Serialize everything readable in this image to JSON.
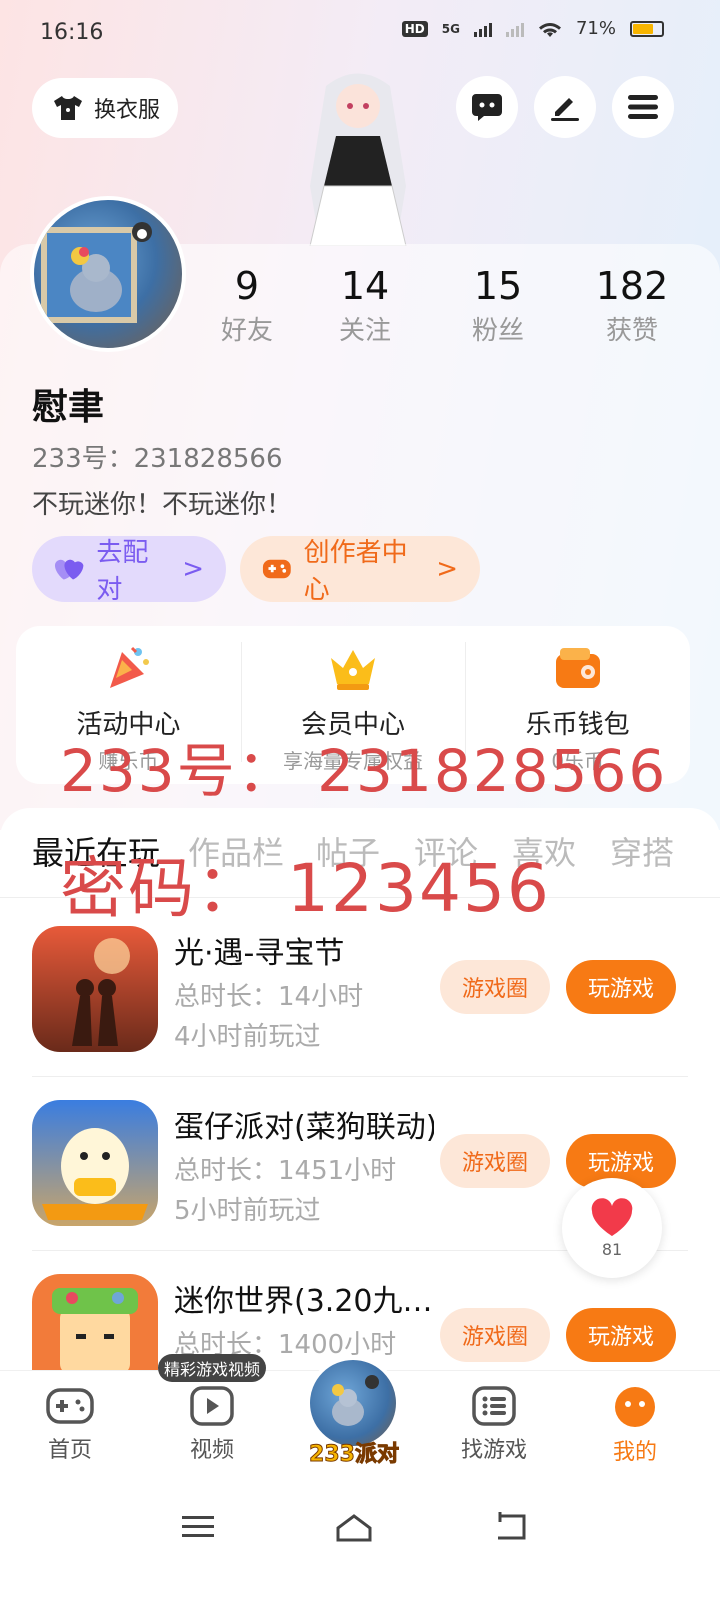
{
  "status_bar": {
    "time": "16:16",
    "hd": "HD",
    "network": "5G",
    "battery": "71%"
  },
  "header": {
    "outfit_label": "换衣服"
  },
  "profile": {
    "stats": [
      {
        "value": "9",
        "label": "好友"
      },
      {
        "value": "14",
        "label": "关注"
      },
      {
        "value": "15",
        "label": "粉丝"
      },
      {
        "value": "182",
        "label": "获赞"
      }
    ],
    "name": "慰聿",
    "uid": "233号：231828566",
    "bio": "不玩迷你！不玩迷你！",
    "match_label": "去配对",
    "creator_label": "创作者中心",
    "chevron": ">"
  },
  "entries": [
    {
      "title": "活动中心",
      "sub": "赚乐币"
    },
    {
      "title": "会员中心",
      "sub": "享海量专属权益"
    },
    {
      "title": "乐币钱包",
      "sub": "0乐币"
    }
  ],
  "watermark": {
    "line1": "233号： 231828566",
    "line2": "密码： 123456"
  },
  "tabs": [
    "最近在玩",
    "作品栏",
    "帖子",
    "评论",
    "喜欢",
    "穿搭"
  ],
  "games": [
    {
      "title": "光·遇-寻宝节",
      "total": "总时长：14小时",
      "last": "4小时前玩过"
    },
    {
      "title": "蛋仔派对(菜狗联动)",
      "total": "总时长：1451小时",
      "last": "5小时前玩过"
    },
    {
      "title": "迷你世界(3.20九…",
      "total": "总时长：1400小时",
      "last": ""
    }
  ],
  "game_buttons": {
    "circle": "游戏圈",
    "play": "玩游戏"
  },
  "like_count": "81",
  "nav": {
    "tooltip": "精彩游戏视频",
    "items": [
      "首页",
      "视频",
      "找游戏",
      "我的"
    ],
    "center_label": "233派对"
  },
  "colors": {
    "accent": "#f77a14",
    "purple": "#7b5cf0",
    "watermark": "#d94a4a"
  }
}
